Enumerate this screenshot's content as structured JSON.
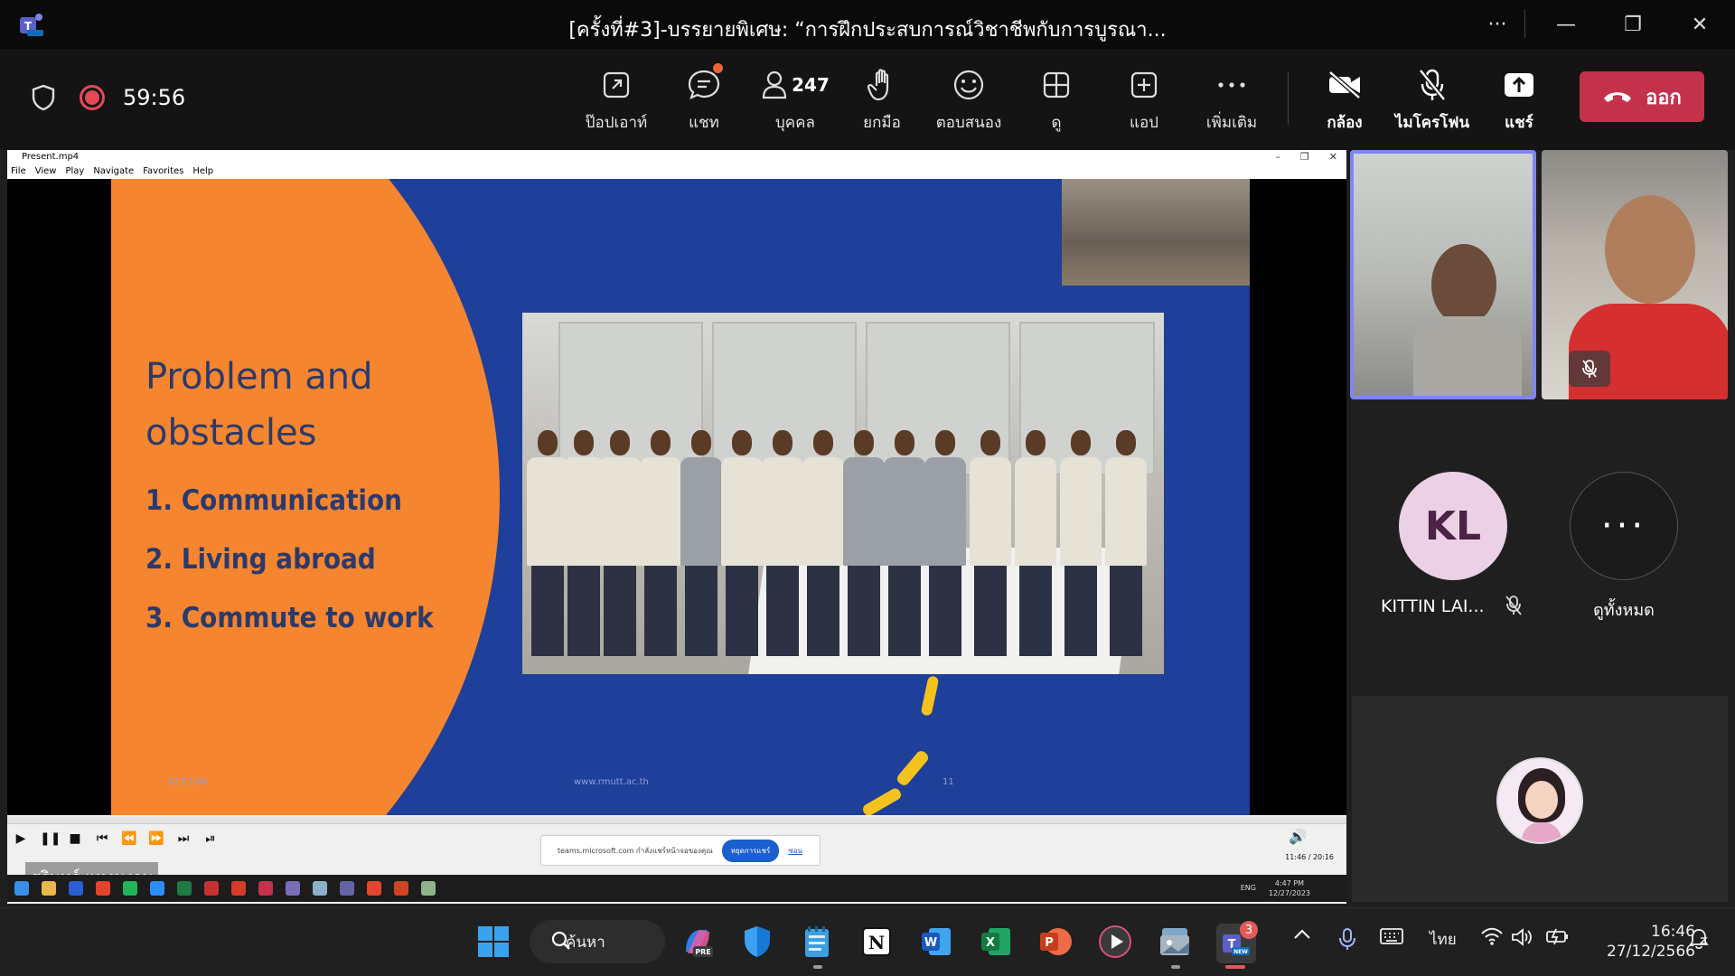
{
  "window": {
    "title": "[ครั้งที่#3]-บรรยายพิเศษ: “การฝึกประสบการณ์วิชาชีพกับการบูรณา...",
    "more": "···",
    "minimize": "—",
    "restore": "❐",
    "close": "✕"
  },
  "meeting": {
    "timer": "59:56",
    "participants_count": "247",
    "tools": {
      "popout": "ป๊อปเอาท์",
      "chat": "แชท",
      "people": "บุคคล",
      "raise_hand": "ยกมือ",
      "react": "ตอบสนอง",
      "view": "ดู",
      "apps": "แอป",
      "more": "เพิ่มเติม",
      "camera": "กล้อง",
      "mic": "ไมโครโฟน",
      "share": "แชร์"
    },
    "leave_label": "ออก"
  },
  "player": {
    "title": "Present.mp4",
    "menu": [
      "File",
      "View",
      "Play",
      "Navigate",
      "Favorites",
      "Help"
    ],
    "time": "11:46 / 20:16",
    "share_banner_text": "teams.microsoft.com กำลังแชร์หน้าจอของคุณ",
    "share_banner_stop": "หยุดการแชร์",
    "share_banner_hide": "ซ่อน",
    "inner_clock_time": "4:47 PM",
    "inner_clock_date": "12/27/2023",
    "inner_lang": "ENG"
  },
  "slide": {
    "title_line1": "Problem and",
    "title_line2": "obstacles",
    "items": [
      "1. Communication",
      "2. Living abroad",
      "3. Commute to work"
    ],
    "foot_date": "02/11/66",
    "foot_url": "www.rmutt.ac.th",
    "foot_page": "11"
  },
  "presenter": {
    "name": "สุรินทร์ แหงมงาม"
  },
  "participants": {
    "kl_initials": "KL",
    "kl_name": "KITTIN LAI...",
    "view_all": "ดูทั้งหมด",
    "more_dots": "···"
  },
  "taskbar": {
    "search_label": "ค้นหา",
    "lang": "ไทย",
    "clock_time": "16:46",
    "clock_date": "27/12/2566",
    "teams_badge": "3"
  },
  "colors": {
    "leave_button": "#c4314b",
    "active_speaker_border": "#7f85f5",
    "slide_bg": "#1e3f9a",
    "slide_orange": "#f6852f",
    "record": "#e74856"
  }
}
